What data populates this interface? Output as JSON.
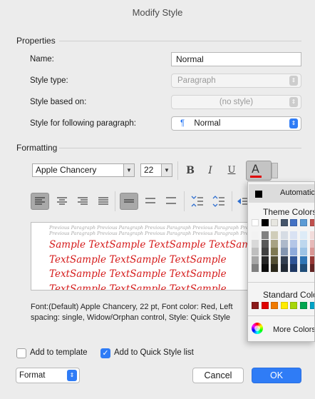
{
  "window": {
    "title": "Modify Style"
  },
  "properties": {
    "heading": "Properties",
    "name_label": "Name:",
    "name_value": "Normal",
    "style_type_label": "Style type:",
    "style_type_value": "Paragraph",
    "based_on_label": "Style based on:",
    "based_on_value": "(no style)",
    "following_label": "Style for following paragraph:",
    "following_value": "Normal",
    "following_icon": "¶"
  },
  "formatting": {
    "heading": "Formatting",
    "font": "Apple Chancery",
    "size": "22",
    "bold": "B",
    "italic": "I",
    "underline": "U",
    "font_color_letter": "A"
  },
  "preview": {
    "previous_text": "Previous Paragraph Previous Paragraph Previous Paragraph Previous Paragraph Previous Paragraph Previous Paragraph Previous Paragraph Previous Paragraph Previous Paragraph Previous Paragraph Previous Paragraph",
    "sample_lines": [
      "Sample TextSample TextSample TextSample",
      "TextSample TextSample TextSample",
      "TextSample TextSample TextSample",
      "TextSample TextSample TextSample"
    ]
  },
  "description": {
    "line1": "Font:(Default) Apple Chancery, 22 pt, Font color: Red, Left",
    "line2": "spacing:  single, Widow/Orphan control, Style: Quick Style"
  },
  "options": {
    "add_to_template": "Add to template",
    "add_to_template_checked": false,
    "add_to_quick_style": "Add to Quick Style list",
    "add_to_quick_style_checked": true
  },
  "footer": {
    "format": "Format",
    "cancel": "Cancel",
    "ok": "OK"
  },
  "color_palette": {
    "automatic": "Automatic",
    "theme_colors": "Theme Colors",
    "standard_colors": "Standard Colors",
    "more_colors": "More Colors",
    "theme_top": [
      "#ffffff",
      "#000000",
      "#e7e6e0",
      "#44546a",
      "#4472c4",
      "#5b9bd5",
      "#c0504d",
      "#9bbb59"
    ],
    "theme_columns": [
      [
        "#f2f2f2",
        "#d9d9d9",
        "#bfbfbf",
        "#a6a6a6",
        "#808080"
      ],
      [
        "#808080",
        "#595959",
        "#404040",
        "#262626",
        "#0d0d0d"
      ],
      [
        "#d0cdb9",
        "#a8a283",
        "#7f7952",
        "#544f33",
        "#2b281a"
      ],
      [
        "#d6dce4",
        "#adb9ca",
        "#8496b0",
        "#333f50",
        "#222a35"
      ],
      [
        "#d9e2f3",
        "#b4c6e7",
        "#8eaadb",
        "#2f5496",
        "#1f3864"
      ],
      [
        "#ddebf7",
        "#bdd7ee",
        "#9cc3e5",
        "#2e75b5",
        "#1f4e79"
      ],
      [
        "#f2dcdb",
        "#e6b9b8",
        "#d99694",
        "#953734",
        "#632423"
      ],
      [
        "#ebf1de",
        "#d7e4bd",
        "#c3d69b",
        "#76923c",
        "#4f6228"
      ]
    ],
    "standard": [
      "#8b1a1a",
      "#e00000",
      "#f07a00",
      "#ffeb00",
      "#a6d608",
      "#00a64f",
      "#00a3c7",
      "#0070c0"
    ]
  }
}
